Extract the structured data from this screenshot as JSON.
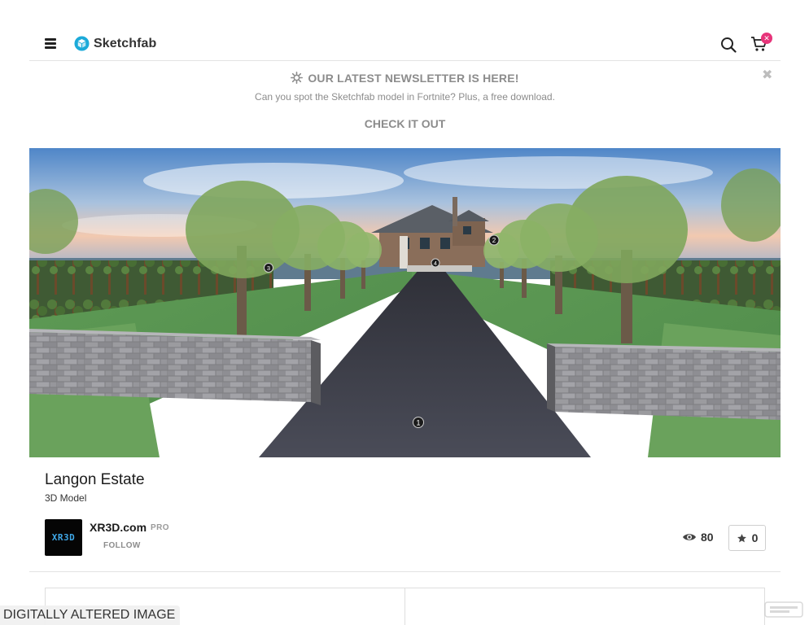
{
  "header": {
    "logo_text": "Sketchfab",
    "cart_badge": "✕"
  },
  "banner": {
    "title": "OUR LATEST NEWSLETTER IS HERE!",
    "subtitle": "Can you spot the Sketchfab model in Fortnite? Plus, a free download.",
    "cta": "CHECK IT OUT",
    "close": "✖"
  },
  "viewer": {
    "hotspots": [
      "1",
      "2",
      "3",
      "4"
    ]
  },
  "model": {
    "title": "Langon Estate",
    "type": "3D Model",
    "avatar_text": "XR3D",
    "author": "XR3D.com",
    "author_badge": "PRO",
    "follow": "FOLLOW",
    "views": "80",
    "likes": "0"
  },
  "overlay": {
    "label": "DIGITALLY ALTERED IMAGE"
  },
  "colors": {
    "accent": "#1caad9",
    "badge": "#e7347a",
    "muted_text": "#8c8c8c"
  }
}
